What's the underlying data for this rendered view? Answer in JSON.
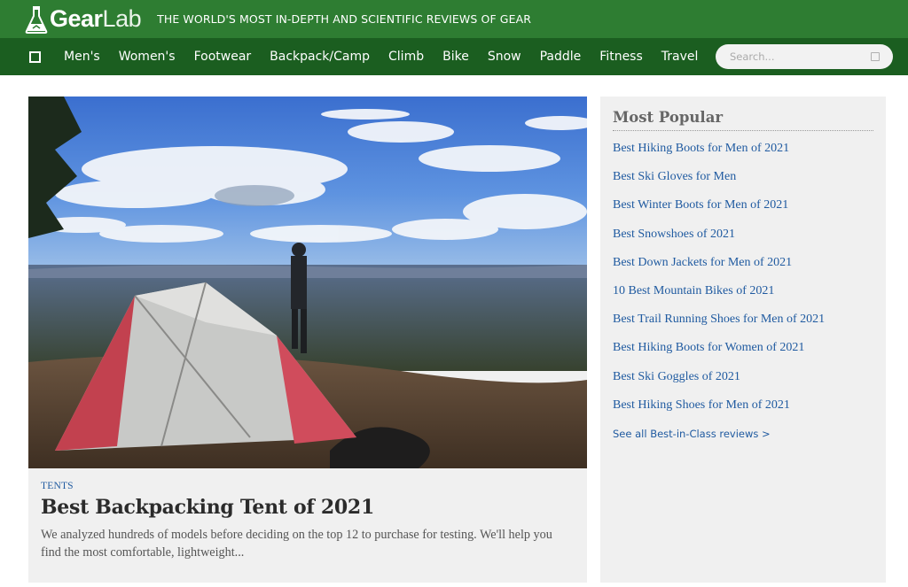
{
  "header": {
    "logo_gear": "Gear",
    "logo_lab": "Lab",
    "tagline": "THE WORLD'S MOST IN-DEPTH AND SCIENTIFIC REVIEWS OF GEAR"
  },
  "nav": {
    "items": [
      "Men's",
      "Women's",
      "Footwear",
      "Backpack/Camp",
      "Climb",
      "Bike",
      "Snow",
      "Paddle",
      "Fitness",
      "Travel"
    ],
    "search_placeholder": "Search..."
  },
  "feature": {
    "category": "TENTS",
    "title": "Best Backpacking Tent of 2021",
    "description": "We analyzed hundreds of models before deciding on the top 12 to purchase for testing. We'll help you find the most comfortable, lightweight..."
  },
  "sidebar": {
    "title": "Most Popular",
    "items": [
      "Best Hiking Boots for Men of 2021",
      "Best Ski Gloves for Men",
      "Best Winter Boots for Men of 2021",
      "Best Snowshoes of 2021",
      "Best Down Jackets for Men of 2021",
      "10 Best Mountain Bikes of 2021",
      "Best Trail Running Shoes for Men of 2021",
      "Best Hiking Boots for Women of 2021",
      "Best Ski Goggles of 2021",
      "Best Hiking Shoes for Men of 2021"
    ],
    "see_all": "See all Best-in-Class reviews >"
  },
  "colors": {
    "topbar": "#2e7d32",
    "navbar": "#1b5e20",
    "link": "#1f5aa0",
    "panel": "#f0f0f0"
  }
}
